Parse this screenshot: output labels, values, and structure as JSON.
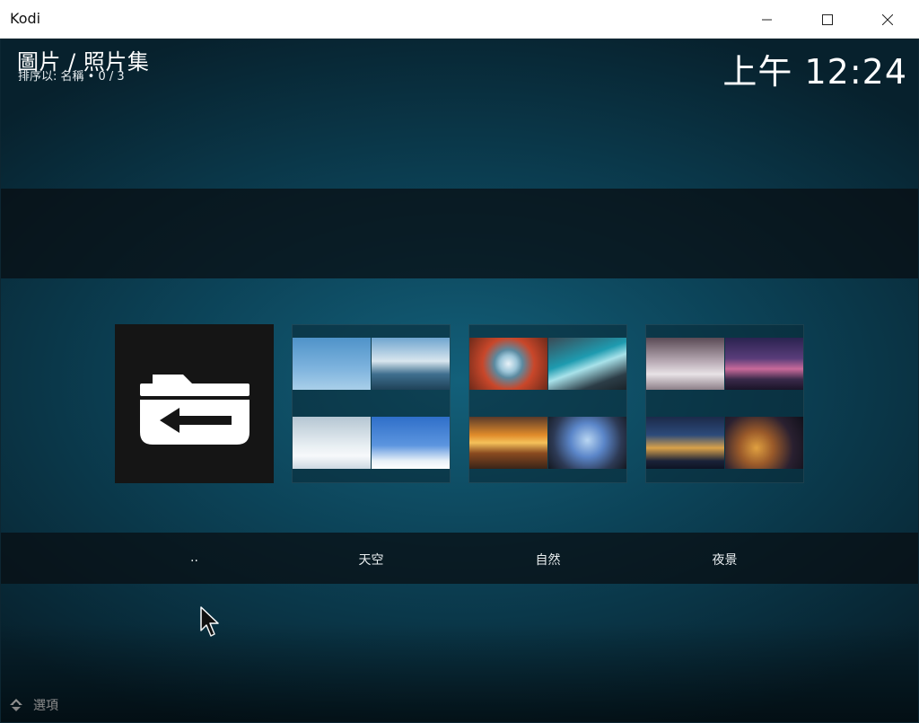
{
  "window": {
    "title": "Kodi"
  },
  "header": {
    "title": "圖片 / 照片集",
    "subtitle": "排序以: 名稱 • 0 / 3",
    "clock": "上午 12:24"
  },
  "items": [
    {
      "label": "..",
      "icon": "folder-back-icon"
    },
    {
      "label": "天空",
      "thumbnails": [
        "sky-photo",
        "clouds-photo",
        "cloud-sea-photo",
        "blue-sky-photo"
      ]
    },
    {
      "label": "自然",
      "thumbnails": [
        "dandelion-photo",
        "wave-photo",
        "sunset-photo",
        "tree-canopy-photo"
      ]
    },
    {
      "label": "夜景",
      "thumbnails": [
        "foggy-city-photo",
        "bridge-night-photo",
        "skyline-night-photo",
        "city-lights-photo"
      ]
    }
  ],
  "footer": {
    "options_label": "選項",
    "icon": "options-icon"
  }
}
